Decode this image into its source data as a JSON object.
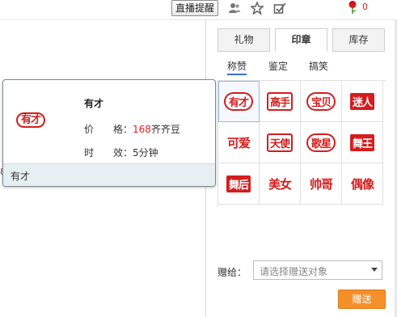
{
  "topbar": {
    "live_reminder": "直播提醒",
    "icons": [
      "person-icon",
      "star-icon",
      "checkin-icon"
    ],
    "flower_count": "0"
  },
  "panel": {
    "tabs": [
      {
        "label": "礼物"
      },
      {
        "label": "印章",
        "active": true
      },
      {
        "label": "库存"
      }
    ],
    "subtabs": [
      {
        "label": "称赞",
        "active": true
      },
      {
        "label": "鉴定"
      },
      {
        "label": "搞笑"
      }
    ],
    "stamps": [
      {
        "text": "有才",
        "style": "oval"
      },
      {
        "text": "高手",
        "style": "box"
      },
      {
        "text": "宝贝",
        "style": "oval"
      },
      {
        "text": "迷人",
        "style": "solid"
      },
      {
        "text": "可爱",
        "style": "plain"
      },
      {
        "text": "天使",
        "style": "box"
      },
      {
        "text": "歌星",
        "style": "oval"
      },
      {
        "text": "舞王",
        "style": "solid"
      },
      {
        "text": "舞后",
        "style": "solid"
      },
      {
        "text": "美女",
        "style": "plain"
      },
      {
        "text": "帅哥",
        "style": "plain"
      },
      {
        "text": "偶像",
        "style": "plain"
      }
    ],
    "give_label": "赠给：",
    "give_placeholder": "请选择赠送对象",
    "send_label": "赠送"
  },
  "popup": {
    "stamp_text": "有才",
    "name": "有才",
    "price_label": "价　　格：",
    "price_value": "168",
    "price_unit": "齐齐豆",
    "duration_label": "时　　效：",
    "duration_value": "5分钟",
    "footer": "有才"
  },
  "side_char": "8",
  "colors": {
    "accent_orange": "#f4902a",
    "stamp_red": "#d51d1d",
    "price_red": "#e02020"
  }
}
